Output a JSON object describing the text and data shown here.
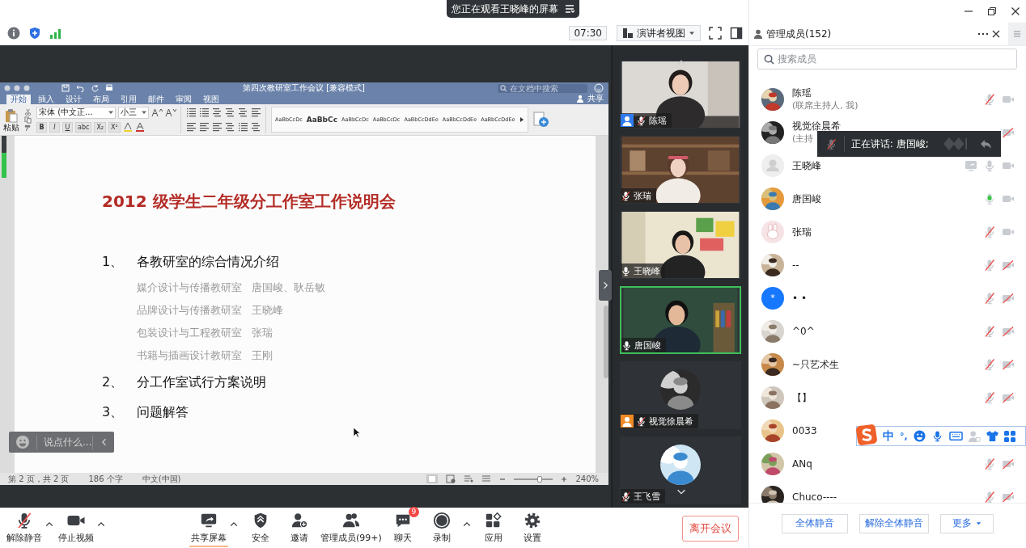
{
  "banner": {
    "text": "您正在观看王晓峰的屏幕"
  },
  "top_bar": {
    "time": "07:30",
    "view_mode": "演讲者视图"
  },
  "shared_document": {
    "title": "第四次教研室工作会议 [兼容模式]",
    "search_placeholder": "在文档中搜索",
    "share_label": "共享",
    "tabs": [
      {
        "label": "开始",
        "selected": true
      },
      {
        "label": "插入",
        "selected": false
      },
      {
        "label": "设计",
        "selected": false
      },
      {
        "label": "布局",
        "selected": false
      },
      {
        "label": "引用",
        "selected": false
      },
      {
        "label": "邮件",
        "selected": false
      },
      {
        "label": "审阅",
        "selected": false
      },
      {
        "label": "视图",
        "selected": false
      }
    ],
    "ribbon": {
      "paste_label": "粘贴",
      "font": "宋体 (中文正...",
      "size": "小三",
      "format_buttons": [
        "B",
        "I",
        "U",
        "abc",
        "X₂",
        "X²"
      ],
      "styles": [
        {
          "sample": "AaBbCcDc",
          "bold": false
        },
        {
          "sample": "AaBbCc",
          "bold": true
        },
        {
          "sample": "AaBbCcDc",
          "bold": false
        },
        {
          "sample": "AaBbCcDc",
          "bold": false
        },
        {
          "sample": "AaBbCcDdEe",
          "bold": false
        },
        {
          "sample": "AaBbCcDdEe",
          "bold": false
        },
        {
          "sample": "AaBbCcDdEe",
          "bold": false
        }
      ]
    },
    "heading": "2012 级学生二年级分工作室工作说明会",
    "items": [
      {
        "number": "1、",
        "text": "各教研室的综合情况介绍",
        "children": [
          {
            "text": "媒介设计与传播教研室   唐国峻、耿岳敏"
          },
          {
            "text": "品牌设计与传播教研室   王晓峰"
          },
          {
            "text": "包装设计与工程教研室   张瑞"
          },
          {
            "text": "书籍与插画设计教研室   王刚"
          }
        ]
      },
      {
        "number": "2、",
        "text": "分工作室试行方案说明"
      },
      {
        "number": "3、",
        "text": "问题解答"
      }
    ],
    "status": {
      "page": "第 2 页，共 2 页",
      "words": "186 个字",
      "language": "中文(中国)",
      "zoom": "240%"
    },
    "zoom_slider": {
      "level": 0.65
    }
  },
  "volume_meter": {
    "level": 0.6
  },
  "chat_box": {
    "placeholder": "说点什么..."
  },
  "video_tiles": [
    {
      "name": "陈瑶",
      "kind": "video",
      "muted": true,
      "badge": true,
      "color": "#2f7bf0",
      "active": false
    },
    {
      "name": "张瑞",
      "kind": "video",
      "muted": true,
      "badge": false,
      "active": false
    },
    {
      "name": "王晓峰",
      "kind": "video",
      "muted": false,
      "badge": false,
      "active": false
    },
    {
      "name": "唐国峻",
      "kind": "video",
      "muted": false,
      "badge": false,
      "active": true
    },
    {
      "name": "视觉徐晨希",
      "kind": "avatar",
      "muted": true,
      "badge": true,
      "color": "#f08a24",
      "active": false
    },
    {
      "name": "王飞雪",
      "kind": "avatar",
      "muted": true,
      "badge": false,
      "active": false
    }
  ],
  "panel": {
    "title": "管理成员(152)",
    "search_placeholder": "搜索成员",
    "members": [
      {
        "name": "陈瑶",
        "role": "(联席主持人, 我)",
        "kind": "picture",
        "sharing": false,
        "mic_muted": true,
        "speaking": false,
        "video_off": false
      },
      {
        "name": "视觉徐晨希",
        "role": "(主持",
        "kind": "picture",
        "sharing": false,
        "video_off": true
      },
      {
        "name": "王晓峰",
        "kind": "placeholder",
        "sharing": true,
        "mic_muted": false,
        "speaking": false,
        "video_off": false
      },
      {
        "name": "唐国峻",
        "kind": "picture",
        "sharing": false,
        "mic_muted": false,
        "speaking": true,
        "video_off": false
      },
      {
        "name": "张瑞",
        "kind": "rabbit",
        "sharing": false,
        "mic_muted": true,
        "speaking": false,
        "video_off": false
      },
      {
        "name": "--",
        "kind": "picture",
        "sharing": false,
        "mic_muted": true,
        "speaking": false,
        "video_off": true
      },
      {
        "name": "• •",
        "kind": "text",
        "avatar_text": "*",
        "sharing": false,
        "mic_muted": true,
        "speaking": false,
        "video_off": true
      },
      {
        "name": "^0^",
        "kind": "picture",
        "sharing": false,
        "mic_muted": true,
        "speaking": false,
        "video_off": true
      },
      {
        "name": "~只艺术生",
        "kind": "picture",
        "sharing": false,
        "mic_muted": true,
        "speaking": false,
        "video_off": true
      },
      {
        "name": "【】",
        "kind": "picture",
        "sharing": false,
        "mic_muted": true,
        "speaking": false,
        "video_off": true
      },
      {
        "name": "0033",
        "kind": "picture",
        "sharing": false
      },
      {
        "name": "ANq",
        "kind": "picture",
        "sharing": false,
        "mic_muted": true,
        "speaking": false,
        "video_off": true
      },
      {
        "name": "Chuco----",
        "kind": "picture",
        "sharing": false,
        "mic_muted": true,
        "speaking": false,
        "video_off": true
      }
    ],
    "buttons": [
      "全体静音",
      "解除全体静音"
    ],
    "more": "更多"
  },
  "speaking_popup": {
    "text": "正在讲话: 唐国峻;"
  },
  "ime_bar": {
    "mode": "中",
    "punctuation": "°,"
  },
  "toolbar": {
    "left_controls": [
      {
        "label": "解除静音",
        "kind": "audio",
        "muted": true,
        "menu": true,
        "active": false
      },
      {
        "label": "停止视频",
        "kind": "video",
        "menu": true,
        "active": false
      }
    ],
    "center_controls": [
      {
        "label": "共享屏幕",
        "kind": "share",
        "menu": true,
        "active": true
      },
      {
        "label": "安全",
        "kind": "security",
        "menu": false,
        "active": false
      },
      {
        "label": "邀请",
        "kind": "invite",
        "menu": false,
        "active": false
      },
      {
        "label": "管理成员(99+)",
        "kind": "participants",
        "menu": false,
        "active": false
      },
      {
        "label": "聊天",
        "kind": "chat",
        "menu": false,
        "active": false,
        "badge": "9"
      },
      {
        "label": "录制",
        "kind": "record",
        "menu": true,
        "active": false
      },
      {
        "label": "应用",
        "kind": "apps",
        "menu": false,
        "active": false
      },
      {
        "label": "设置",
        "kind": "settings",
        "menu": false,
        "active": false
      }
    ],
    "leave": "离开会议"
  }
}
